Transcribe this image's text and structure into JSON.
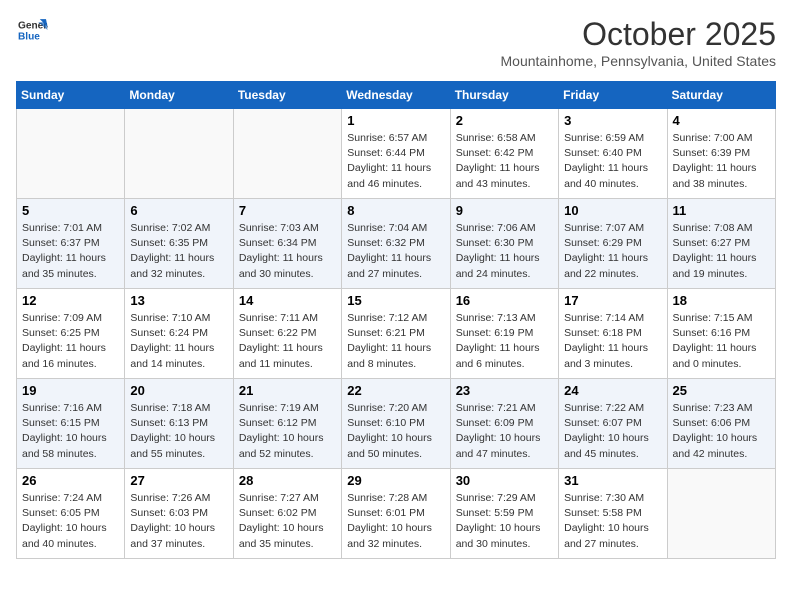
{
  "header": {
    "logo_line1": "General",
    "logo_line2": "Blue",
    "month": "October 2025",
    "location": "Mountainhome, Pennsylvania, United States"
  },
  "days_of_week": [
    "Sunday",
    "Monday",
    "Tuesday",
    "Wednesday",
    "Thursday",
    "Friday",
    "Saturday"
  ],
  "weeks": [
    [
      {
        "day": "",
        "info": ""
      },
      {
        "day": "",
        "info": ""
      },
      {
        "day": "",
        "info": ""
      },
      {
        "day": "1",
        "info": "Sunrise: 6:57 AM\nSunset: 6:44 PM\nDaylight: 11 hours\nand 46 minutes."
      },
      {
        "day": "2",
        "info": "Sunrise: 6:58 AM\nSunset: 6:42 PM\nDaylight: 11 hours\nand 43 minutes."
      },
      {
        "day": "3",
        "info": "Sunrise: 6:59 AM\nSunset: 6:40 PM\nDaylight: 11 hours\nand 40 minutes."
      },
      {
        "day": "4",
        "info": "Sunrise: 7:00 AM\nSunset: 6:39 PM\nDaylight: 11 hours\nand 38 minutes."
      }
    ],
    [
      {
        "day": "5",
        "info": "Sunrise: 7:01 AM\nSunset: 6:37 PM\nDaylight: 11 hours\nand 35 minutes."
      },
      {
        "day": "6",
        "info": "Sunrise: 7:02 AM\nSunset: 6:35 PM\nDaylight: 11 hours\nand 32 minutes."
      },
      {
        "day": "7",
        "info": "Sunrise: 7:03 AM\nSunset: 6:34 PM\nDaylight: 11 hours\nand 30 minutes."
      },
      {
        "day": "8",
        "info": "Sunrise: 7:04 AM\nSunset: 6:32 PM\nDaylight: 11 hours\nand 27 minutes."
      },
      {
        "day": "9",
        "info": "Sunrise: 7:06 AM\nSunset: 6:30 PM\nDaylight: 11 hours\nand 24 minutes."
      },
      {
        "day": "10",
        "info": "Sunrise: 7:07 AM\nSunset: 6:29 PM\nDaylight: 11 hours\nand 22 minutes."
      },
      {
        "day": "11",
        "info": "Sunrise: 7:08 AM\nSunset: 6:27 PM\nDaylight: 11 hours\nand 19 minutes."
      }
    ],
    [
      {
        "day": "12",
        "info": "Sunrise: 7:09 AM\nSunset: 6:25 PM\nDaylight: 11 hours\nand 16 minutes."
      },
      {
        "day": "13",
        "info": "Sunrise: 7:10 AM\nSunset: 6:24 PM\nDaylight: 11 hours\nand 14 minutes."
      },
      {
        "day": "14",
        "info": "Sunrise: 7:11 AM\nSunset: 6:22 PM\nDaylight: 11 hours\nand 11 minutes."
      },
      {
        "day": "15",
        "info": "Sunrise: 7:12 AM\nSunset: 6:21 PM\nDaylight: 11 hours\nand 8 minutes."
      },
      {
        "day": "16",
        "info": "Sunrise: 7:13 AM\nSunset: 6:19 PM\nDaylight: 11 hours\nand 6 minutes."
      },
      {
        "day": "17",
        "info": "Sunrise: 7:14 AM\nSunset: 6:18 PM\nDaylight: 11 hours\nand 3 minutes."
      },
      {
        "day": "18",
        "info": "Sunrise: 7:15 AM\nSunset: 6:16 PM\nDaylight: 11 hours\nand 0 minutes."
      }
    ],
    [
      {
        "day": "19",
        "info": "Sunrise: 7:16 AM\nSunset: 6:15 PM\nDaylight: 10 hours\nand 58 minutes."
      },
      {
        "day": "20",
        "info": "Sunrise: 7:18 AM\nSunset: 6:13 PM\nDaylight: 10 hours\nand 55 minutes."
      },
      {
        "day": "21",
        "info": "Sunrise: 7:19 AM\nSunset: 6:12 PM\nDaylight: 10 hours\nand 52 minutes."
      },
      {
        "day": "22",
        "info": "Sunrise: 7:20 AM\nSunset: 6:10 PM\nDaylight: 10 hours\nand 50 minutes."
      },
      {
        "day": "23",
        "info": "Sunrise: 7:21 AM\nSunset: 6:09 PM\nDaylight: 10 hours\nand 47 minutes."
      },
      {
        "day": "24",
        "info": "Sunrise: 7:22 AM\nSunset: 6:07 PM\nDaylight: 10 hours\nand 45 minutes."
      },
      {
        "day": "25",
        "info": "Sunrise: 7:23 AM\nSunset: 6:06 PM\nDaylight: 10 hours\nand 42 minutes."
      }
    ],
    [
      {
        "day": "26",
        "info": "Sunrise: 7:24 AM\nSunset: 6:05 PM\nDaylight: 10 hours\nand 40 minutes."
      },
      {
        "day": "27",
        "info": "Sunrise: 7:26 AM\nSunset: 6:03 PM\nDaylight: 10 hours\nand 37 minutes."
      },
      {
        "day": "28",
        "info": "Sunrise: 7:27 AM\nSunset: 6:02 PM\nDaylight: 10 hours\nand 35 minutes."
      },
      {
        "day": "29",
        "info": "Sunrise: 7:28 AM\nSunset: 6:01 PM\nDaylight: 10 hours\nand 32 minutes."
      },
      {
        "day": "30",
        "info": "Sunrise: 7:29 AM\nSunset: 5:59 PM\nDaylight: 10 hours\nand 30 minutes."
      },
      {
        "day": "31",
        "info": "Sunrise: 7:30 AM\nSunset: 5:58 PM\nDaylight: 10 hours\nand 27 minutes."
      },
      {
        "day": "",
        "info": ""
      }
    ]
  ]
}
